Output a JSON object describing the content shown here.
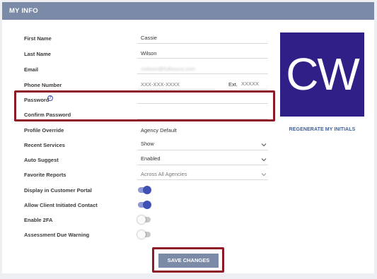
{
  "header": {
    "title": "MY INFO"
  },
  "fields": {
    "first_name": {
      "label": "First Name",
      "value": "Cassie"
    },
    "last_name": {
      "label": "Last Name",
      "value": "Wilson"
    },
    "email": {
      "label": "Email",
      "value": "cwilson@fullsoccs.com"
    },
    "phone": {
      "label": "Phone Number",
      "placeholder": "XXX-XXX-XXXX",
      "ext_label": "Ext.",
      "ext_placeholder": "XXXXX"
    },
    "password": {
      "label": "Password",
      "help_glyph": "?"
    },
    "confirm_password": {
      "label": "Confirm Password"
    },
    "profile_override": {
      "label": "Profile Override",
      "value": "Agency Default"
    },
    "recent_services": {
      "label": "Recent Services",
      "value": "Show"
    },
    "auto_suggest": {
      "label": "Auto Suggest",
      "value": "Enabled"
    },
    "favorite_reports": {
      "label": "Favorite Reports",
      "value": "Across All Agencies"
    }
  },
  "toggles": {
    "display_portal": {
      "label": "Display in Customer Portal",
      "on": true
    },
    "allow_client_contact": {
      "label": "Allow Client Initiated Contact",
      "on": true
    },
    "enable_2fa": {
      "label": "Enable 2FA",
      "on": false
    },
    "assessment_warning": {
      "label": "Assessment Due Warning",
      "on": false
    }
  },
  "avatar": {
    "initials": "CW",
    "bg_color": "#2f1f86"
  },
  "regenerate_label": "REGENERATE MY INITIALS",
  "save_label": "SAVE CHANGES",
  "colors": {
    "header": "#7b8aa6",
    "highlight": "#8d1a26",
    "toggle_on": "#3f51b5"
  }
}
